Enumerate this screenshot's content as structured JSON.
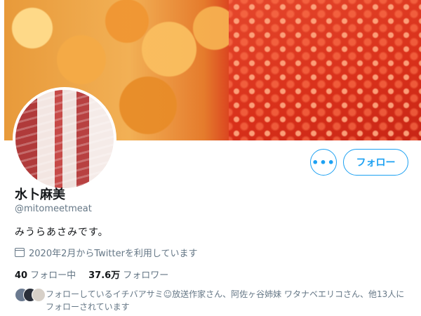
{
  "profile": {
    "name": "水卜麻美",
    "handle": "@mitomeetmeat",
    "bio": "みうらあさみです。",
    "joined": "2020年2月からTwitterを利用しています"
  },
  "actions": {
    "more_label": "•••",
    "follow_label": "フォロー"
  },
  "stats": {
    "following_count": "40",
    "following_label": "フォロー中",
    "followers_count": "37.6万",
    "followers_label": "フォロワー"
  },
  "followed_by": {
    "text": "フォローしているイチバアサミ☺放送作家さん、阿佐ヶ谷姉妹 ワタナベエリコさん、他13人にフォローされています"
  },
  "icons": {
    "calendar": "calendar-icon",
    "more": "more-icon"
  },
  "colors": {
    "accent": "#1da1f2",
    "secondary_text": "#657786",
    "primary_text": "#14171a"
  }
}
